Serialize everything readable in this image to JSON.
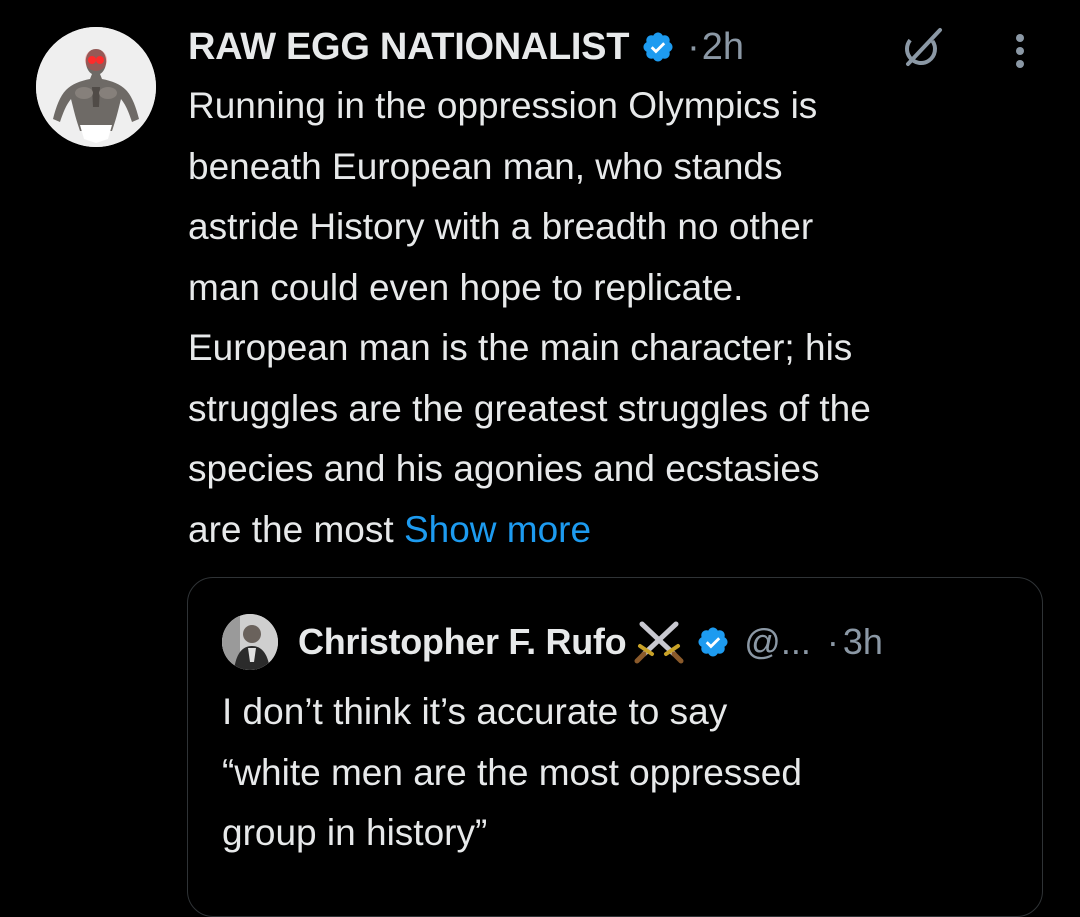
{
  "tweet": {
    "display_name": "RAW EGG NATIONALIST",
    "separator": "·",
    "time": "2h",
    "avatar_icon": "bodybuilder-avatar",
    "verified_icon": "verified-badge-icon",
    "grok_icon": "grok-icon",
    "more_icon": "more-options-icon",
    "text_lines": [
      "Running in the oppression Olympics is",
      "beneath European man, who stands",
      "astride History with a breadth no other",
      "man could even hope to replicate.",
      "European man is the main character; his",
      "struggles are the greatest struggles of the",
      "species and his agonies and ecstasies",
      "are the most "
    ],
    "show_more": "Show more"
  },
  "quote": {
    "display_name": "Christopher F. Rufo",
    "emoji_icon": "crossed-swords-icon",
    "verified_icon": "verified-badge-icon",
    "handle": "@...",
    "separator": "·",
    "time": "3h",
    "text_lines": [
      "I don’t think it’s accurate to say",
      "“white men are the most oppressed",
      "group in history”"
    ]
  },
  "colors": {
    "background": "#000000",
    "text": "#e7e9ea",
    "secondary_text": "#8b98a5",
    "link": "#1d9bf0",
    "verified": "#1d9bf0",
    "border": "#2f3336"
  }
}
